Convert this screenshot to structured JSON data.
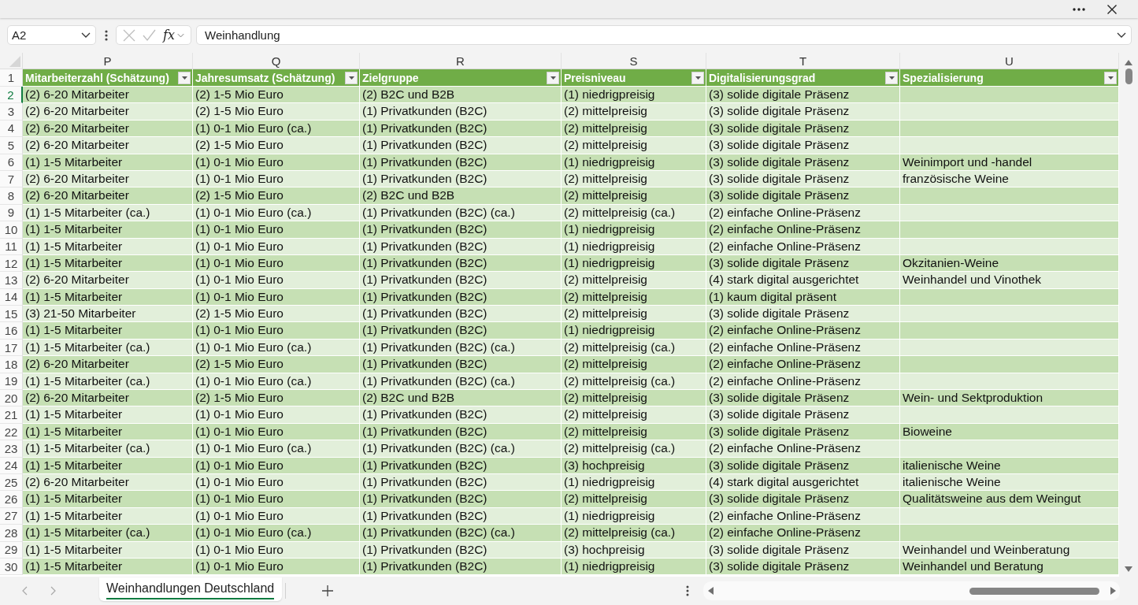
{
  "formula_bar": {
    "name_box": "A2",
    "buttons": [
      {
        "kind": "cancel",
        "disabled": true
      },
      {
        "kind": "enter",
        "disabled": true
      }
    ],
    "function_label": "fx",
    "formula": "Weinhandlung"
  },
  "sheet": {
    "columns": [
      "P",
      "Q",
      "R",
      "S",
      "T",
      "U"
    ],
    "header_row": {
      "number": "1",
      "cells": [
        "Mitarbeiterzahl (Schätzung)",
        "Jahresumsatz (Schätzung)",
        "Zielgruppe",
        "Preisniveau",
        "Digitalisierungsgrad",
        "Spezialisierung"
      ]
    },
    "rows": [
      {
        "number": "2",
        "selected": true,
        "cells": [
          "(2) 6-20 Mitarbeiter",
          "(2) 1-5 Mio Euro",
          "(2) B2C und B2B",
          "(1) niedrigpreisig",
          "(3) solide digitale Präsenz"
        ]
      },
      {
        "number": "3",
        "selected": false,
        "cells": [
          "(2) 6-20 Mitarbeiter",
          "(2) 1-5 Mio Euro",
          "(1) Privatkunden (B2C)",
          "(2) mittelpreisig",
          "(3) solide digitale Präsenz"
        ]
      },
      {
        "number": "4",
        "selected": false,
        "cells": [
          "(2) 6-20 Mitarbeiter",
          "(1) 0-1 Mio Euro (ca.)",
          "(1) Privatkunden (B2C)",
          "(2) mittelpreisig",
          "(3) solide digitale Präsenz"
        ]
      },
      {
        "number": "5",
        "selected": false,
        "cells": [
          "(2) 6-20 Mitarbeiter",
          "(2) 1-5 Mio Euro",
          "(1) Privatkunden (B2C)",
          "(2) mittelpreisig",
          "(3) solide digitale Präsenz"
        ]
      },
      {
        "number": "6",
        "selected": false,
        "cells": [
          "(1) 1-5 Mitarbeiter",
          "(1) 0-1 Mio Euro",
          "(1) Privatkunden (B2C)",
          "(1) niedrigpreisig",
          "(3) solide digitale Präsenz",
          "Weinimport und -handel"
        ]
      },
      {
        "number": "7",
        "selected": false,
        "cells": [
          "(2) 6-20 Mitarbeiter",
          "(1) 0-1 Mio Euro",
          "(1) Privatkunden (B2C)",
          "(2) mittelpreisig",
          "(3) solide digitale Präsenz",
          "französische Weine"
        ]
      },
      {
        "number": "8",
        "selected": false,
        "cells": [
          "(2) 6-20 Mitarbeiter",
          "(2) 1-5 Mio Euro",
          "(2) B2C und B2B",
          "(2) mittelpreisig",
          "(3) solide digitale Präsenz"
        ]
      },
      {
        "number": "9",
        "selected": false,
        "cells": [
          "(1) 1-5 Mitarbeiter (ca.)",
          "(1) 0-1 Mio Euro (ca.)",
          "(1) Privatkunden (B2C) (ca.)",
          "(2) mittelpreisig (ca.)",
          "(2) einfache Online-Präsenz"
        ]
      },
      {
        "number": "10",
        "selected": false,
        "cells": [
          "(1) 1-5 Mitarbeiter",
          "(1) 0-1 Mio Euro",
          "(1) Privatkunden (B2C)",
          "(1) niedrigpreisig",
          "(2) einfache Online-Präsenz"
        ]
      },
      {
        "number": "11",
        "selected": false,
        "cells": [
          "(1) 1-5 Mitarbeiter",
          "(1) 0-1 Mio Euro",
          "(1) Privatkunden (B2C)",
          "(1) niedrigpreisig",
          "(2) einfache Online-Präsenz"
        ]
      },
      {
        "number": "12",
        "selected": false,
        "cells": [
          "(1) 1-5 Mitarbeiter",
          "(1) 0-1 Mio Euro",
          "(1) Privatkunden (B2C)",
          "(1) niedrigpreisig",
          "(3) solide digitale Präsenz",
          "Okzitanien-Weine"
        ]
      },
      {
        "number": "13",
        "selected": false,
        "cells": [
          "(2) 6-20 Mitarbeiter",
          "(1) 0-1 Mio Euro",
          "(1) Privatkunden (B2C)",
          "(2) mittelpreisig",
          "(4) stark digital ausgerichtet",
          "Weinhandel und Vinothek"
        ]
      },
      {
        "number": "14",
        "selected": false,
        "cells": [
          "(1) 1-5 Mitarbeiter",
          "(1) 0-1 Mio Euro",
          "(1) Privatkunden (B2C)",
          "(2) mittelpreisig",
          "(1) kaum digital präsent"
        ]
      },
      {
        "number": "15",
        "selected": false,
        "cells": [
          "(3) 21-50 Mitarbeiter",
          "(2) 1-5 Mio Euro",
          "(1) Privatkunden (B2C)",
          "(2) mittelpreisig",
          "(3) solide digitale Präsenz"
        ]
      },
      {
        "number": "16",
        "selected": false,
        "cells": [
          "(1) 1-5 Mitarbeiter",
          "(1) 0-1 Mio Euro",
          "(1) Privatkunden (B2C)",
          "(1) niedrigpreisig",
          "(2) einfache Online-Präsenz"
        ]
      },
      {
        "number": "17",
        "selected": false,
        "cells": [
          "(1) 1-5 Mitarbeiter (ca.)",
          "(1) 0-1 Mio Euro (ca.)",
          "(1) Privatkunden (B2C) (ca.)",
          "(2) mittelpreisig (ca.)",
          "(2) einfache Online-Präsenz"
        ]
      },
      {
        "number": "18",
        "selected": false,
        "cells": [
          "(2) 6-20 Mitarbeiter",
          "(2) 1-5 Mio Euro",
          "(1) Privatkunden (B2C)",
          "(2) mittelpreisig",
          "(2) einfache Online-Präsenz"
        ]
      },
      {
        "number": "19",
        "selected": false,
        "cells": [
          "(1) 1-5 Mitarbeiter (ca.)",
          "(1) 0-1 Mio Euro (ca.)",
          "(1) Privatkunden (B2C) (ca.)",
          "(2) mittelpreisig (ca.)",
          "(2) einfache Online-Präsenz"
        ]
      },
      {
        "number": "20",
        "selected": false,
        "cells": [
          "(2) 6-20 Mitarbeiter",
          "(2) 1-5 Mio Euro",
          "(2) B2C und B2B",
          "(2) mittelpreisig",
          "(3) solide digitale Präsenz",
          "Wein- und Sektproduktion"
        ]
      },
      {
        "number": "21",
        "selected": false,
        "cells": [
          "(1) 1-5 Mitarbeiter",
          "(1) 0-1 Mio Euro",
          "(1) Privatkunden (B2C)",
          "(2) mittelpreisig",
          "(3) solide digitale Präsenz"
        ]
      },
      {
        "number": "22",
        "selected": false,
        "cells": [
          "(1) 1-5 Mitarbeiter",
          "(1) 0-1 Mio Euro",
          "(1) Privatkunden (B2C)",
          "(2) mittelpreisig",
          "(3) solide digitale Präsenz",
          "Bioweine"
        ]
      },
      {
        "number": "23",
        "selected": false,
        "cells": [
          "(1) 1-5 Mitarbeiter (ca.)",
          "(1) 0-1 Mio Euro (ca.)",
          "(1) Privatkunden (B2C) (ca.)",
          "(2) mittelpreisig (ca.)",
          "(2) einfache Online-Präsenz"
        ]
      },
      {
        "number": "24",
        "selected": false,
        "cells": [
          "(1) 1-5 Mitarbeiter",
          "(1) 0-1 Mio Euro",
          "(1) Privatkunden (B2C)",
          "(3) hochpreisig",
          "(3) solide digitale Präsenz",
          "italienische Weine"
        ]
      },
      {
        "number": "25",
        "selected": false,
        "cells": [
          "(2) 6-20 Mitarbeiter",
          "(1) 0-1 Mio Euro",
          "(1) Privatkunden (B2C)",
          "(1) niedrigpreisig",
          "(4) stark digital ausgerichtet",
          "italienische Weine"
        ]
      },
      {
        "number": "26",
        "selected": false,
        "cells": [
          "(1) 1-5 Mitarbeiter",
          "(1) 0-1 Mio Euro",
          "(1) Privatkunden (B2C)",
          "(2) mittelpreisig",
          "(3) solide digitale Präsenz",
          "Qualitätsweine aus dem Weingut"
        ]
      },
      {
        "number": "27",
        "selected": false,
        "cells": [
          "(1) 1-5 Mitarbeiter",
          "(1) 0-1 Mio Euro",
          "(1) Privatkunden (B2C)",
          "(1) niedrigpreisig",
          "(2) einfache Online-Präsenz"
        ]
      },
      {
        "number": "28",
        "selected": false,
        "cells": [
          "(1) 1-5 Mitarbeiter (ca.)",
          "(1) 0-1 Mio Euro (ca.)",
          "(1) Privatkunden (B2C) (ca.)",
          "(2) mittelpreisig (ca.)",
          "(2) einfache Online-Präsenz"
        ]
      },
      {
        "number": "29",
        "selected": false,
        "cells": [
          "(1) 1-5 Mitarbeiter",
          "(1) 0-1 Mio Euro",
          "(1) Privatkunden (B2C)",
          "(3) hochpreisig",
          "(3) solide digitale Präsenz",
          "Weinhandel und Weinberatung"
        ]
      },
      {
        "number": "30",
        "selected": false,
        "cells": [
          "(1) 1-5 Mitarbeiter",
          "(1) 0-1 Mio Euro",
          "(1) Privatkunden (B2C)",
          "(1) niedrigpreisig",
          "(3) solide digitale Präsenz",
          "Weinhandel und Beratung"
        ]
      }
    ]
  },
  "sheet_tabs": [
    {
      "label": "Weinhandlungen Deutschland",
      "selected": true
    }
  ]
}
